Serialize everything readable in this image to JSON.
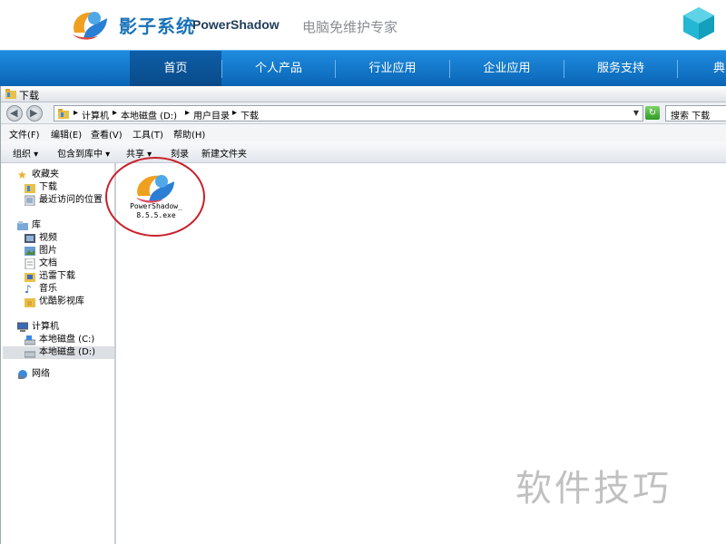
{
  "site": {
    "brand_cn": "影子系统",
    "brand_en": "PowerShadow",
    "slogan": "电脑免维护专家",
    "nav": [
      {
        "label": "首页",
        "active": true
      },
      {
        "label": "个人产品"
      },
      {
        "label": "行业应用"
      },
      {
        "label": "企业应用"
      },
      {
        "label": "服务支持"
      },
      {
        "label": "典"
      }
    ],
    "colors": {
      "nav": "#1580d0",
      "brand": "#1a73b8"
    }
  },
  "window": {
    "title": "下载",
    "address": {
      "crumbs": [
        "计算机",
        "本地磁盘 (D:)",
        "用户目录",
        "下载"
      ]
    },
    "search": {
      "placeholder": "搜索 下载"
    },
    "menu": [
      "文件(F)",
      "编辑(E)",
      "查看(V)",
      "工具(T)",
      "帮助(H)"
    ],
    "commands": [
      "组织 ▾",
      "包含到库中 ▾",
      "共享 ▾",
      "刻录",
      "新建文件夹"
    ],
    "sidebar": {
      "favorites": {
        "label": "收藏夹",
        "items": [
          "下载",
          "最近访问的位置"
        ]
      },
      "library": {
        "label": "库",
        "items": [
          "视频",
          "图片",
          "文档",
          "迅雷下载",
          "音乐",
          "优酷影视库"
        ]
      },
      "computer": {
        "label": "计算机",
        "items": [
          "本地磁盘 (C:)",
          "本地磁盘 (D:)"
        ]
      },
      "network": {
        "label": "网络"
      }
    },
    "files": [
      {
        "name": "PowerShadow_8.5.5.exe",
        "icon": "powershadow-app-icon"
      }
    ]
  },
  "watermark": "软件技巧"
}
